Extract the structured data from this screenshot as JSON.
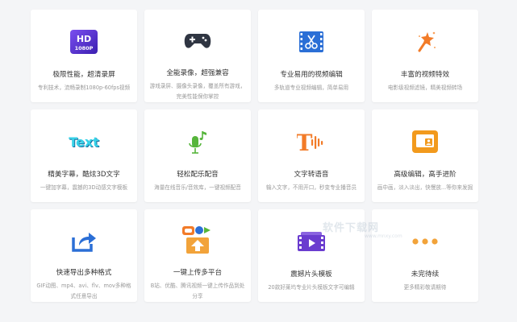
{
  "cards": [
    {
      "title": "极限性能，超清录屏",
      "desc": "专利技术，流畅录制1080p-60fps视频",
      "icon": "hd-1080p-icon",
      "hd_text": "HD",
      "hd_sub": "1080P"
    },
    {
      "title": "全能录像，超强兼容",
      "desc": "游戏录屏、摄像头录像，覆盖所有游戏，完美性能保你掌控",
      "icon": "gamepad-icon"
    },
    {
      "title": "专业易用的视频编辑",
      "desc": "多轨道专业视频编辑，简单易用",
      "icon": "video-scissors-icon"
    },
    {
      "title": "丰富的视频特效",
      "desc": "电影级视频滤镜，精美视频转场",
      "icon": "magic-wand-icon"
    },
    {
      "title": "精美字幕，酷炫3D文字",
      "desc": "一键加字幕，震撼的3D动感文字模板",
      "icon": "text-3d-icon",
      "icon_text": "Text"
    },
    {
      "title": "轻松配乐配音",
      "desc": "海量在线音乐/音效库，一键视频配音",
      "icon": "mic-music-icon"
    },
    {
      "title": "文字转语音",
      "desc": "输入文字，不用开口，秒变专业播音员",
      "icon": "text-to-speech-icon",
      "icon_text": "T"
    },
    {
      "title": "高级编辑，高手进阶",
      "desc": "画中画，淡入淡出，快慢放...等你来发掘",
      "icon": "advanced-edit-icon"
    },
    {
      "title": "快速导出多种格式",
      "desc": "GIF动图、mp4、avi、flv、mov多种格式任意导出",
      "icon": "export-icon"
    },
    {
      "title": "一键上传多平台",
      "desc": "B站、优酷、腾讯视频一键上传作品到处分享",
      "icon": "upload-platform-icon"
    },
    {
      "title": "震撼片头模板",
      "desc": "20款好莱坞专业片头模板文字可编辑",
      "icon": "film-template-icon"
    },
    {
      "title": "未完待续",
      "desc": "更多精彩敬请期待",
      "icon": "more-icon"
    }
  ],
  "watermark": {
    "text": "软件下载网",
    "sub": "www.mnxy.com"
  },
  "colors": {
    "hd": "#5b2fd1",
    "gamepad": "#2f3542",
    "blue": "#2b6fd6",
    "orange": "#f27b28",
    "green": "#56b53b",
    "purple": "#6a3ccf",
    "text_cyan": "#37d2e8"
  }
}
